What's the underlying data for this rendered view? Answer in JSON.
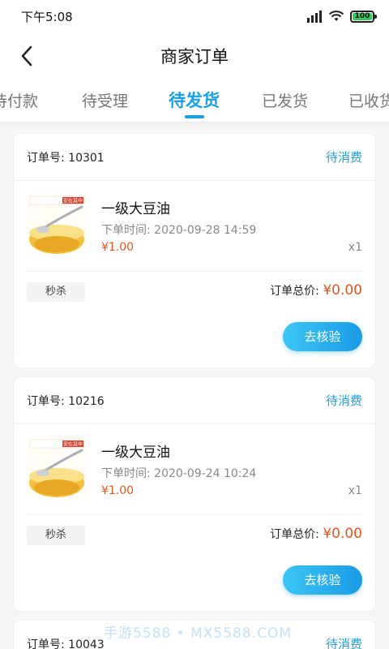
{
  "status_bar": {
    "time": "下午5:08",
    "battery": "100"
  },
  "header": {
    "title": "商家订单"
  },
  "tabs": [
    {
      "label": "待付款"
    },
    {
      "label": "待受理"
    },
    {
      "label": "待发货"
    },
    {
      "label": "已发货"
    },
    {
      "label": "已收货"
    }
  ],
  "orders": [
    {
      "order_no": "订单号: 10301",
      "state": "待消费",
      "goods_name": "一级大豆油",
      "order_time": "下单时间: 2020-09-28 14:59",
      "price": "¥1.00",
      "qty": "x1",
      "tag": "秒杀",
      "total_label": "订单总价: ",
      "total_amount": "¥0.00",
      "action": "去核验",
      "thumb_text": "安在其中"
    },
    {
      "order_no": "订单号: 10216",
      "state": "待消费",
      "goods_name": "一级大豆油",
      "order_time": "下单时间: 2020-09-24 10:24",
      "price": "¥1.00",
      "qty": "x1",
      "tag": "秒杀",
      "total_label": "订单总价: ",
      "total_amount": "¥0.00",
      "action": "去核验",
      "thumb_text": "安在其中"
    },
    {
      "order_no": "订单号: 10043",
      "state": "待消费"
    }
  ],
  "watermark": "手游5588 • MX5588.COM",
  "colors": {
    "accent": "#1aa0e6",
    "price": "#e8541e"
  }
}
